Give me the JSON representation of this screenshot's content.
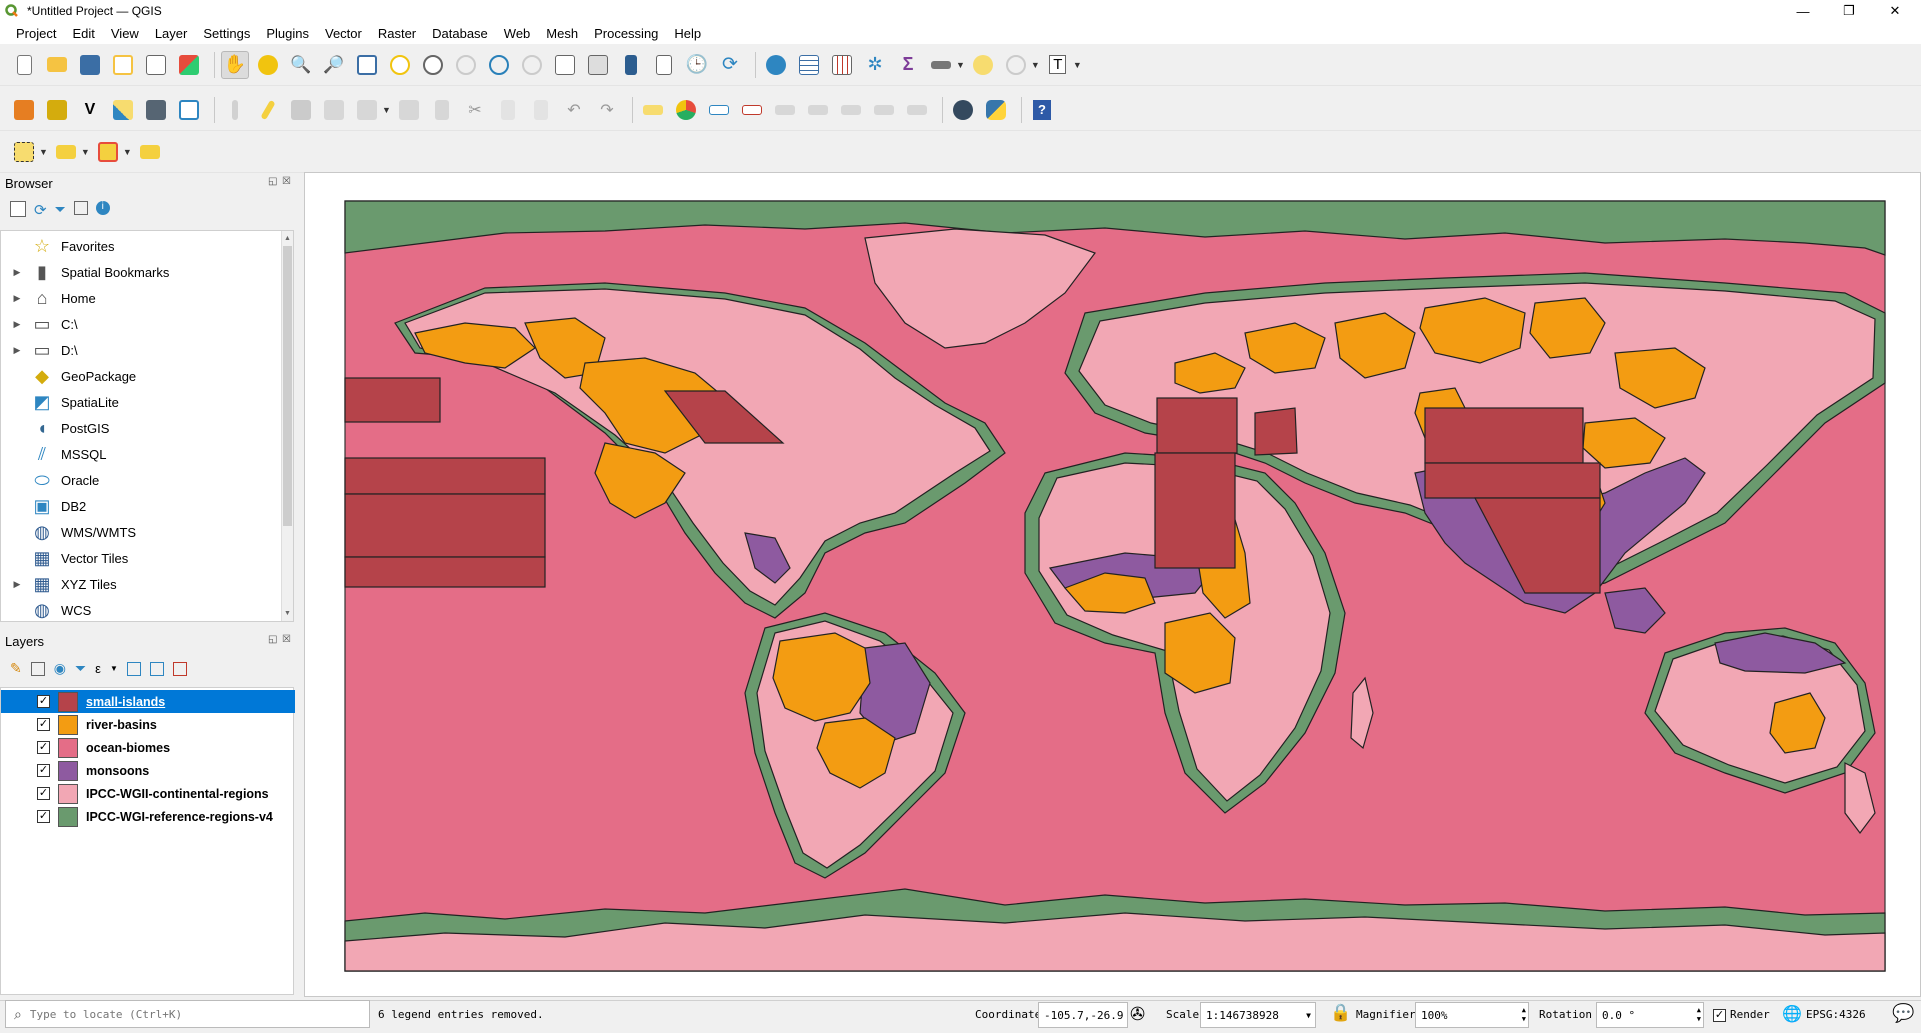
{
  "window": {
    "title": "*Untitled Project — QGIS",
    "minimize": "—",
    "maximize": "❐",
    "close": "✕"
  },
  "menu": [
    "Project",
    "Edit",
    "View",
    "Layer",
    "Settings",
    "Plugins",
    "Vector",
    "Raster",
    "Database",
    "Web",
    "Mesh",
    "Processing",
    "Help"
  ],
  "browser": {
    "title": "Browser",
    "items": [
      {
        "label": "Favorites",
        "icon": "star-icon",
        "expandable": false
      },
      {
        "label": "Spatial Bookmarks",
        "icon": "bookmark-icon",
        "expandable": true
      },
      {
        "label": "Home",
        "icon": "home-folder-icon",
        "expandable": true
      },
      {
        "label": "C:\\",
        "icon": "folder-icon",
        "expandable": true
      },
      {
        "label": "D:\\",
        "icon": "folder-icon",
        "expandable": true
      },
      {
        "label": "GeoPackage",
        "icon": "geopackage-icon",
        "expandable": false
      },
      {
        "label": "SpatiaLite",
        "icon": "spatialite-icon",
        "expandable": false
      },
      {
        "label": "PostGIS",
        "icon": "postgis-elephant-icon",
        "expandable": false
      },
      {
        "label": "MSSQL",
        "icon": "mssql-icon",
        "expandable": false
      },
      {
        "label": "Oracle",
        "icon": "oracle-icon",
        "expandable": false
      },
      {
        "label": "DB2",
        "icon": "db2-icon",
        "expandable": false
      },
      {
        "label": "WMS/WMTS",
        "icon": "globe-icon",
        "expandable": false
      },
      {
        "label": "Vector Tiles",
        "icon": "grid-icon",
        "expandable": false
      },
      {
        "label": "XYZ Tiles",
        "icon": "grid-icon",
        "expandable": true
      },
      {
        "label": "WCS",
        "icon": "globe-icon",
        "expandable": false
      }
    ]
  },
  "layers": {
    "title": "Layers",
    "items": [
      {
        "name": "small-islands",
        "color": "#b5434a",
        "selected": true
      },
      {
        "name": "river-basins",
        "color": "#f39c12",
        "selected": false
      },
      {
        "name": "ocean-biomes",
        "color": "#e46d87",
        "selected": false
      },
      {
        "name": "monsoons",
        "color": "#8e5aa0",
        "selected": false
      },
      {
        "name": "IPCC-WGII-continental-regions",
        "color": "#f2a7b4",
        "selected": false
      },
      {
        "name": "IPCC-WGI-reference-regions-v4",
        "color": "#6a9a6e",
        "selected": false
      }
    ]
  },
  "map_colors": {
    "ocean": "#e46d87",
    "continental": "#f2a7b4",
    "reference": "#6a9a6e",
    "basins": "#f39c12",
    "monsoons": "#8e5aa0",
    "islands": "#b5434a"
  },
  "status": {
    "locate_placeholder": "Type to locate (Ctrl+K)",
    "message": "6 legend entries removed.",
    "coordinate_label": "Coordinate",
    "coordinate_value": "-105.7,-26.9",
    "scale_label": "Scale",
    "scale_value": "1:146738928",
    "magnifier_label": "Magnifier",
    "magnifier_value": "100%",
    "rotation_label": "Rotation",
    "rotation_value": "0.0 °",
    "render_label": "Render",
    "crs": "EPSG:4326"
  }
}
